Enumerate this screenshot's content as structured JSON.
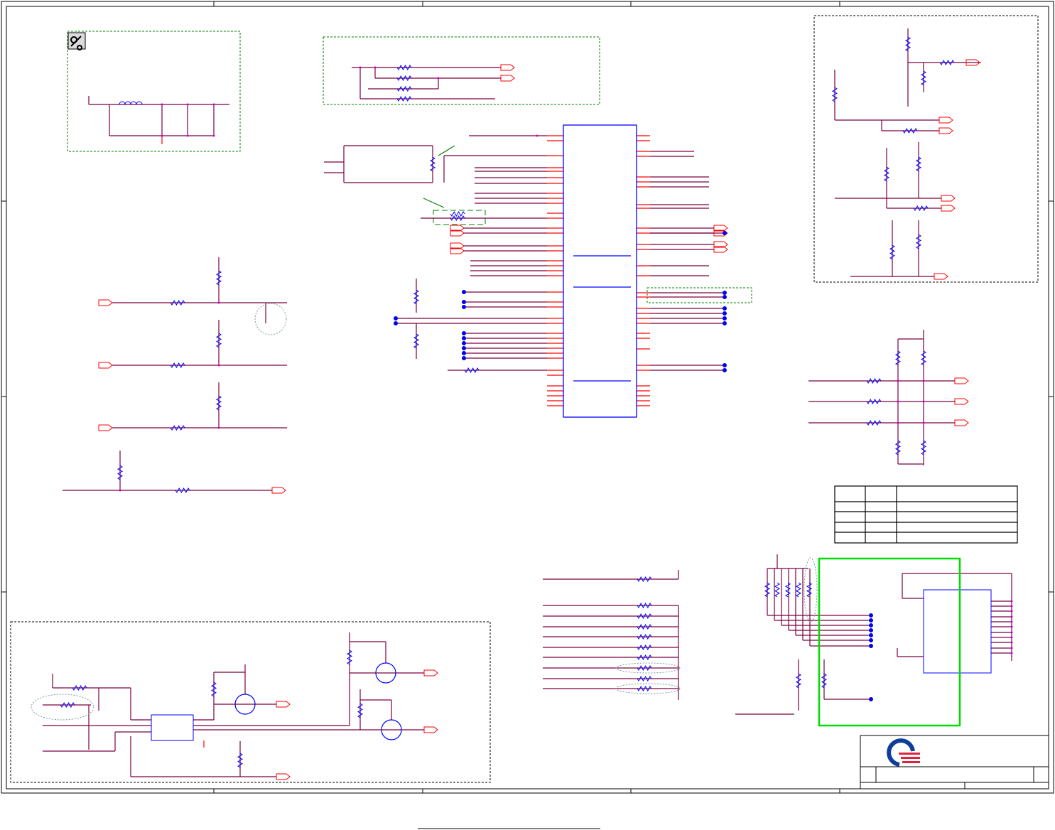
{
  "diagram": {
    "type": "electrical-schematic",
    "colors": {
      "border": "#000000",
      "wire": "#7a0040",
      "pin": "#ff0000",
      "component": "#0000ff",
      "junction": "#cc00cc",
      "net_marker": "#0000ee",
      "group_box": "#008000",
      "highlight_box": "#00dd00",
      "logo_blue": "#0d3f9a",
      "logo_red": "#e0233a"
    },
    "icons": [
      "logo",
      "tool-icon",
      "mosfet-icon",
      "transistor-icon"
    ]
  }
}
